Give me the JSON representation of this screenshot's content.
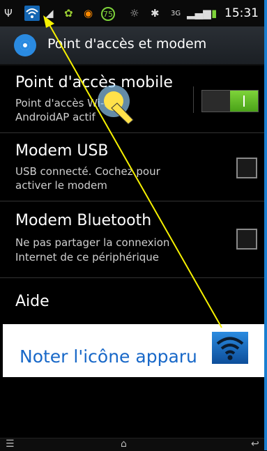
{
  "status_bar": {
    "icons": [
      "usb-icon",
      "wifi-hotspot-icon",
      "signal-icon",
      "settings-icon",
      "sync-icon",
      "battery-75-icon",
      "eye-icon",
      "bluetooth-icon",
      "3g-icon",
      "signal-bars-icon",
      "battery-icon"
    ],
    "badge_75": "75",
    "network": "3G",
    "time": "15:31"
  },
  "action_bar": {
    "title": "Point d'accès et modem",
    "icon": "settings-gear-icon"
  },
  "list": {
    "hotspot": {
      "title": "Point d'accès mobile",
      "subtitle_line1": "Point d'accès Wi-Fi",
      "subtitle_line2": "AndroidAP actif",
      "enabled": true
    },
    "usb": {
      "title": "Modem USB",
      "subtitle_line1": "USB connecté. Cochez pour",
      "subtitle_line2": "activer le modem",
      "checked": false
    },
    "bluetooth": {
      "title": "Modem Bluetooth",
      "subtitle_line1": "Ne pas partager la connexion",
      "subtitle_line2": "Internet de ce périphérique",
      "checked": false
    },
    "help": {
      "title": "Aide"
    }
  },
  "annotation": {
    "text": "Noter l'icône apparu",
    "icon": "wifi-hotspot-icon",
    "arrow_color": "#f7f200"
  },
  "nav": {
    "icons": [
      "menu-icon",
      "home-icon",
      "back-icon"
    ]
  }
}
